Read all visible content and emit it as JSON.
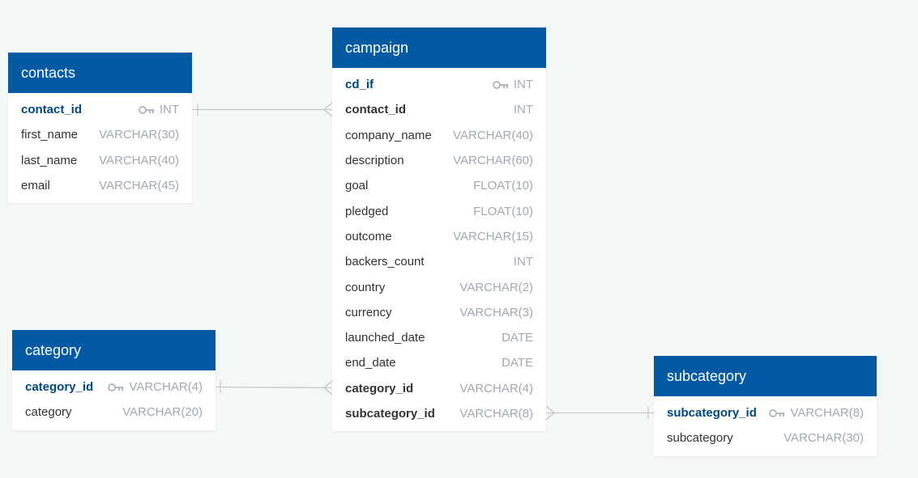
{
  "colors": {
    "header": "#005aa3",
    "pk_text": "#00467f",
    "type_text": "#a4a9ae",
    "connector": "#c8c8c8",
    "background": "#f5f6f6"
  },
  "tables": {
    "contacts": {
      "title": "contacts",
      "columns": [
        {
          "name": "contact_id",
          "type": "INT",
          "pk": true
        },
        {
          "name": "first_name",
          "type": "VARCHAR(30)"
        },
        {
          "name": "last_name",
          "type": "VARCHAR(40)"
        },
        {
          "name": "email",
          "type": "VARCHAR(45)"
        }
      ]
    },
    "campaign": {
      "title": "campaign",
      "columns": [
        {
          "name": "cd_if",
          "type": "INT",
          "pk": true
        },
        {
          "name": "contact_id",
          "type": "INT",
          "fk": true
        },
        {
          "name": "company_name",
          "type": "VARCHAR(40)"
        },
        {
          "name": "description",
          "type": "VARCHAR(60)"
        },
        {
          "name": "goal",
          "type": "FLOAT(10)"
        },
        {
          "name": "pledged",
          "type": "FLOAT(10)"
        },
        {
          "name": "outcome",
          "type": "VARCHAR(15)"
        },
        {
          "name": "backers_count",
          "type": "INT"
        },
        {
          "name": "country",
          "type": "VARCHAR(2)"
        },
        {
          "name": "currency",
          "type": "VARCHAR(3)"
        },
        {
          "name": "launched_date",
          "type": "DATE"
        },
        {
          "name": "end_date",
          "type": "DATE"
        },
        {
          "name": "category_id",
          "type": "VARCHAR(4)",
          "fk": true
        },
        {
          "name": "subcategory_id",
          "type": "VARCHAR(8)",
          "fk": true
        }
      ]
    },
    "category": {
      "title": "category",
      "columns": [
        {
          "name": "category_id",
          "type": "VARCHAR(4)",
          "pk": true
        },
        {
          "name": "category",
          "type": "VARCHAR(20)"
        }
      ]
    },
    "subcategory": {
      "title": "subcategory",
      "columns": [
        {
          "name": "subcategory_id",
          "type": "VARCHAR(8)",
          "pk": true
        },
        {
          "name": "subcategory",
          "type": "VARCHAR(30)"
        }
      ]
    }
  },
  "relationships": [
    {
      "from": "contacts.contact_id",
      "to": "campaign.contact_id",
      "from_end": "one",
      "to_end": "many"
    },
    {
      "from": "category.category_id",
      "to": "campaign.category_id",
      "from_end": "one",
      "to_end": "many"
    },
    {
      "from": "subcategory.subcategory_id",
      "to": "campaign.subcategory_id",
      "from_end": "one",
      "to_end": "many"
    }
  ]
}
